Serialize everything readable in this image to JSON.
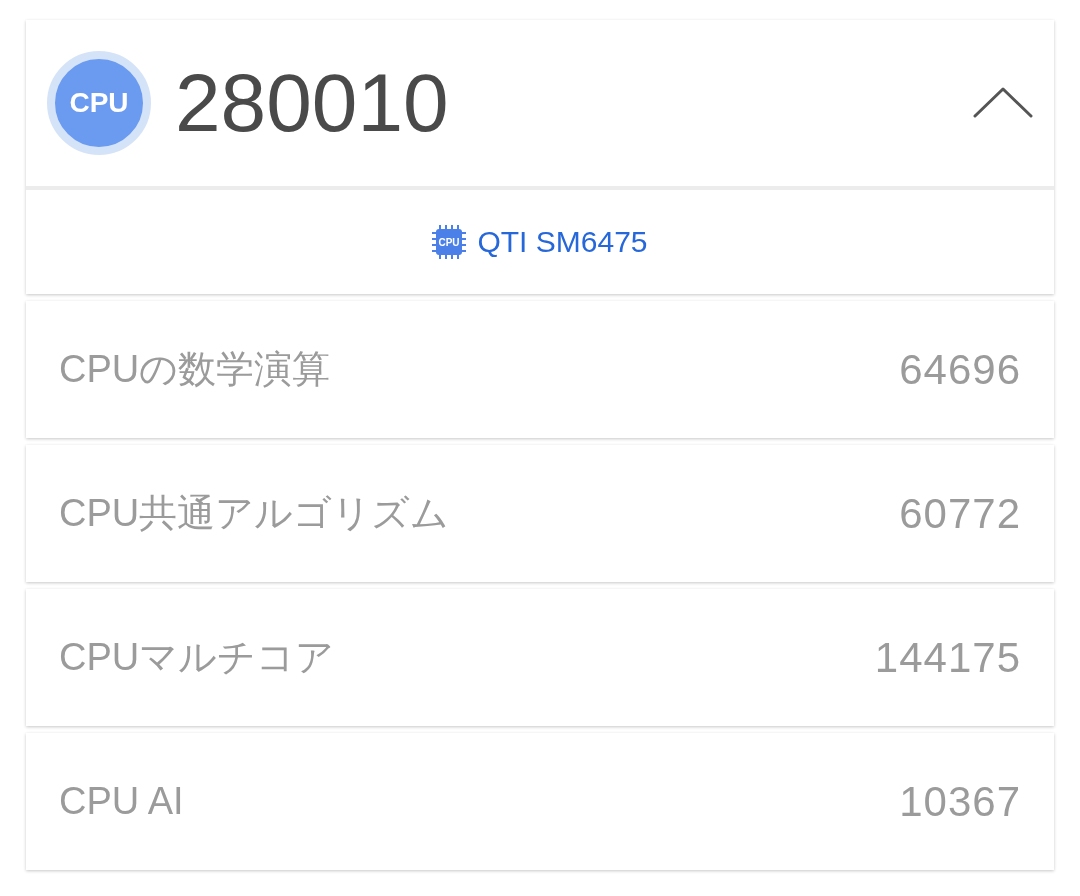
{
  "header": {
    "badge": "CPU",
    "score": "280010",
    "expanded": true
  },
  "chip": {
    "icon_label": "CPU",
    "label": "QTI SM6475"
  },
  "subscores": [
    {
      "label": "CPUの数学演算",
      "score": "64696"
    },
    {
      "label": "CPU共通アルゴリズム",
      "score": "60772"
    },
    {
      "label": "CPUマルチコア",
      "score": "144175"
    },
    {
      "label": "CPU AI",
      "score": "10367"
    }
  ]
}
